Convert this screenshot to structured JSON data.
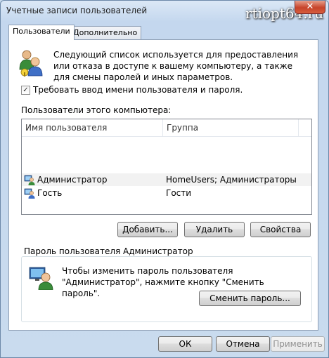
{
  "window": {
    "title": "Учетные записи пользователей",
    "close_glyph": "✕"
  },
  "watermark": "rtiopt64.ru",
  "tabs": [
    {
      "label": "Пользователи",
      "active": true
    },
    {
      "label": "Дополнительно",
      "active": false
    }
  ],
  "intro_text": "Следующий список используется для предоставления или отказа в доступе к вашему компьютеру, а также для смены паролей и иных параметров.",
  "require_login": {
    "label": "Требовать ввод имени пользователя и пароля.",
    "checked": true,
    "check_glyph": "✓"
  },
  "users_list": {
    "caption": "Пользователи этого компьютера:",
    "columns": [
      "Имя пользователя",
      "Группа"
    ],
    "rows": [
      {
        "name": "Администратор",
        "group": "HomeUsers; Администраторы",
        "selected": true
      },
      {
        "name": "Гость",
        "group": "Гости",
        "selected": false
      }
    ]
  },
  "buttons": {
    "add": "Добавить...",
    "remove": "Удалить",
    "properties": "Свойства"
  },
  "password_group": {
    "title": "Пароль пользователя Администратор",
    "text": "Чтобы изменить пароль пользователя \"Администратор\", нажмите кнопку \"Сменить пароль\".",
    "change_button": "Сменить пароль..."
  },
  "footer": {
    "ok": "ОК",
    "cancel": "Отмена",
    "apply": "Применить"
  },
  "icons": {
    "users": "users-icon",
    "user_row": "user-icon",
    "admin": "admin-user-icon"
  }
}
